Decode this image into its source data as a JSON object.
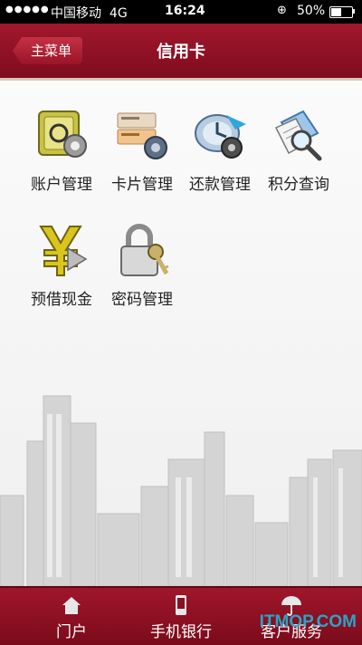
{
  "status": {
    "carrier": "中国移动",
    "network": "4G",
    "time": "16:24",
    "battery": "50%",
    "signal": "●●●●●"
  },
  "nav": {
    "back_label": "主菜单",
    "title": "信用卡"
  },
  "menu": [
    {
      "label": "账户管理",
      "icon": "account-management-icon"
    },
    {
      "label": "卡片管理",
      "icon": "card-management-icon"
    },
    {
      "label": "还款管理",
      "icon": "repayment-management-icon"
    },
    {
      "label": "积分查询",
      "icon": "points-query-icon"
    },
    {
      "label": "预借现金",
      "icon": "cash-advance-icon"
    },
    {
      "label": "密码管理",
      "icon": "password-management-icon"
    }
  ],
  "tabs": [
    {
      "label": "门户",
      "icon": "home-icon"
    },
    {
      "label": "手机银行",
      "icon": "phone-icon"
    },
    {
      "label": "客户服务",
      "icon": "umbrella-icon"
    }
  ],
  "watermark": "ITMOP.COM",
  "colors": {
    "brand": "#8e1124",
    "tab_bar": "#8a1022"
  }
}
